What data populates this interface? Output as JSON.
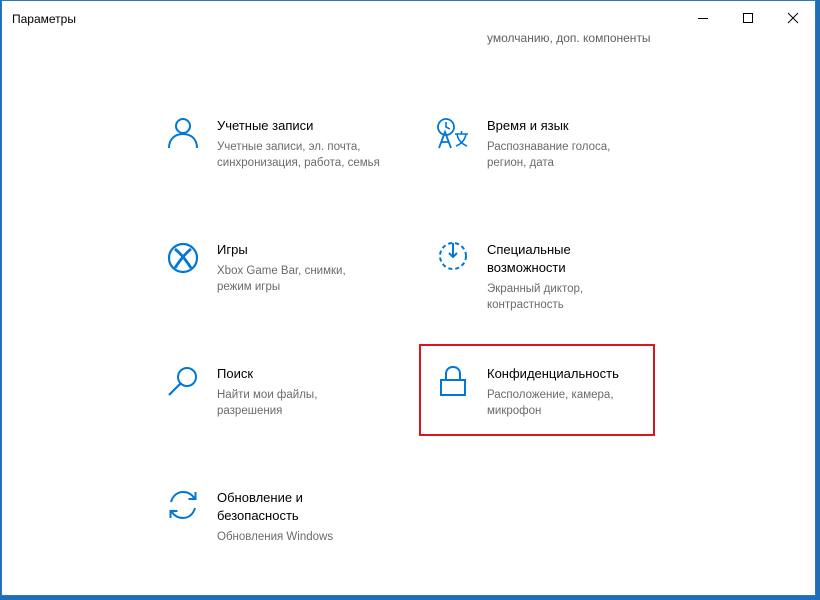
{
  "window": {
    "title": "Параметры"
  },
  "top_partial_text": "умолчанию, доп. компоненты",
  "accent_color": "#0078d7",
  "highlight_color": "#d8171f",
  "tiles": [
    {
      "name": "Учетные записи",
      "desc": "Учетные записи, эл. почта,\nсинхронизация, работа, семья",
      "icon": "person-icon"
    },
    {
      "name": "Время и язык",
      "desc": "Распознавание голоса,\nрегион, дата",
      "icon": "time-language-icon"
    },
    {
      "name": "Игры",
      "desc": "Xbox Game Bar, снимки,\nрежим игры",
      "icon": "xbox-icon"
    },
    {
      "name": "Специальные\nвозможности",
      "desc": "Экранный диктор,\nконтрастность",
      "icon": "accessibility-timer-icon"
    },
    {
      "name": "Поиск",
      "desc": "Найти мои файлы,\nразрешения",
      "icon": "search-icon"
    },
    {
      "name": "Конфиденциальность",
      "desc": "Расположение, камера,\nмикрофон",
      "icon": "lock-icon"
    },
    {
      "name": "Обновление и\nбезопасность",
      "desc": "Обновления Windows",
      "icon": "sync-icon"
    }
  ]
}
